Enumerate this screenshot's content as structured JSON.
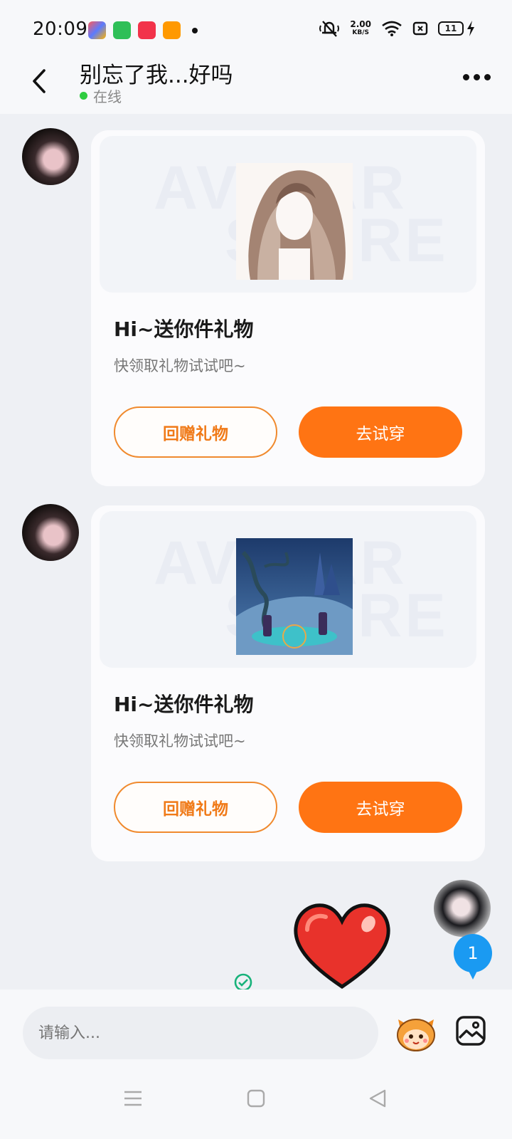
{
  "status_bar": {
    "time": "20:09",
    "speed_value": "2.00",
    "speed_unit": "KB/S",
    "battery": "11"
  },
  "header": {
    "title": "别忘了我...好吗",
    "status": "在线"
  },
  "messages": [
    {
      "watermark_line1": "AVATAR",
      "watermark_line2": "STORE",
      "title": "Hi~送你件礼物",
      "subtitle": "快领取礼物试试吧~",
      "secondary_button": "回赠礼物",
      "primary_button": "去试穿"
    },
    {
      "watermark_line1": "AVATAR",
      "watermark_line2": "STORE",
      "title": "Hi~送你件礼物",
      "subtitle": "快领取礼物试试吧~",
      "secondary_button": "回赠礼物",
      "primary_button": "去试穿"
    }
  ],
  "floating": {
    "unread_count": "1"
  },
  "input": {
    "placeholder": "请输入..."
  },
  "colors": {
    "accent": "#ff7413",
    "online": "#2ecc40",
    "badge": "#1a9af2"
  }
}
